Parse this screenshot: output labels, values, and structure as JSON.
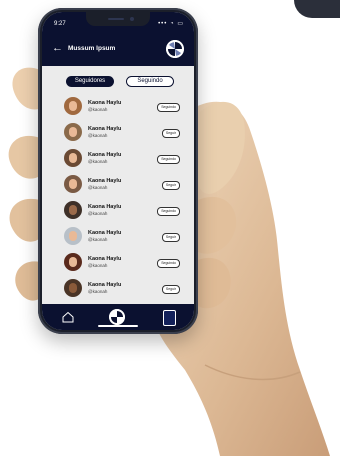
{
  "status_bar": {
    "time": "9:27",
    "icons": "••• ◔ ▭"
  },
  "app_bar": {
    "back_label": "←",
    "title": "Mussum Ipsum"
  },
  "tabs": [
    {
      "label": "Seguidores",
      "active": true
    },
    {
      "label": "Seguindo",
      "active": false
    }
  ],
  "list": [
    {
      "name": "Kaona Haylu",
      "handle": "@kaonah",
      "action": "Seguindo"
    },
    {
      "name": "Kaona Haylu",
      "handle": "@kaonah",
      "action": "Seguir"
    },
    {
      "name": "Kaona Haylu",
      "handle": "@kaonah",
      "action": "Seguindo"
    },
    {
      "name": "Kaona Haylu",
      "handle": "@kaonah",
      "action": "Seguir"
    },
    {
      "name": "Kaona Haylu",
      "handle": "@kaonah",
      "action": "Seguindo"
    },
    {
      "name": "Kaona Haylu",
      "handle": "@kaonah",
      "action": "Seguir"
    },
    {
      "name": "Kaona Haylu",
      "handle": "@kaonah",
      "action": "Seguindo"
    },
    {
      "name": "Kaona Haylu",
      "handle": "@kaonah",
      "action": "Seguir"
    }
  ],
  "bottom_nav": [
    {
      "icon": "home-icon"
    },
    {
      "icon": "app-logo-icon"
    },
    {
      "icon": "profile-icon"
    }
  ],
  "colors": {
    "primary": "#0b1130",
    "screen_bg": "#ebebeb",
    "hand": "#e3c4a4"
  }
}
